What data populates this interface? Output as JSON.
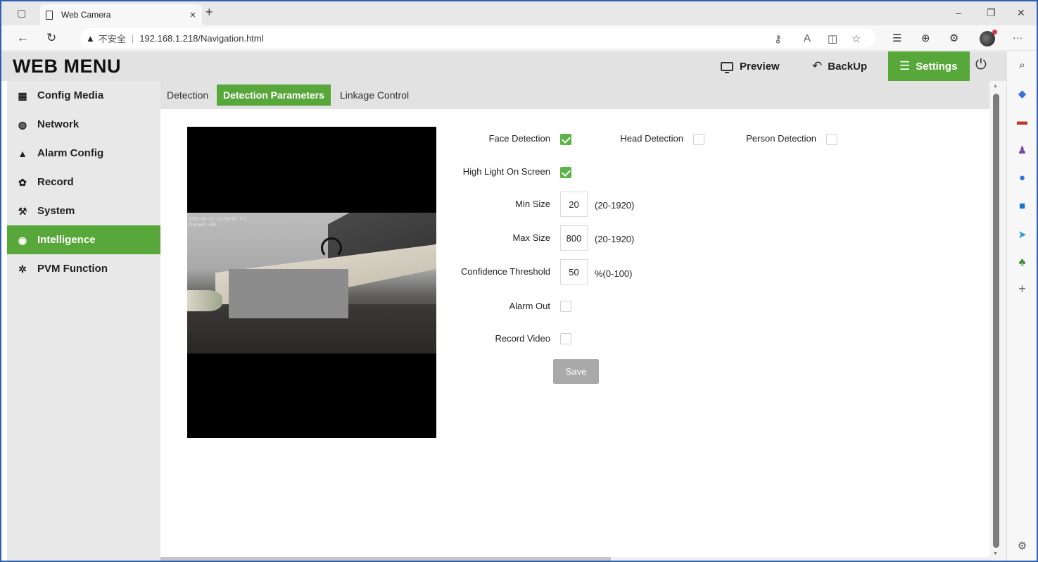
{
  "browser": {
    "tab_title": "Web Camera",
    "tab_close": "×",
    "new_tab": "+",
    "insecure_label": "不安全",
    "url": "192.168.1.218/Navigation.html",
    "window_controls": [
      "–",
      "❐",
      "✕"
    ],
    "more_menu": "···"
  },
  "header": {
    "brand": "WEB MENU",
    "preview": "Preview",
    "backup": "BackUp",
    "settings": "Settings",
    "accent_color": "#57a73a"
  },
  "sidebar": {
    "items": [
      {
        "label": "Config Media",
        "icon": "clapperboard-icon"
      },
      {
        "label": "Network",
        "icon": "globe-icon"
      },
      {
        "label": "Alarm Config",
        "icon": "alarm-icon"
      },
      {
        "label": "Record",
        "icon": "film-reel-icon"
      },
      {
        "label": "System",
        "icon": "wrench-icon"
      },
      {
        "label": "Intelligence",
        "icon": "intelligence-icon",
        "active": true
      },
      {
        "label": "PVM Function",
        "icon": "gear-icon"
      }
    ]
  },
  "subtabs": [
    {
      "label": "Detection"
    },
    {
      "label": "Detection Parameters",
      "active": true
    },
    {
      "label": "Linkage Control"
    }
  ],
  "video": {
    "osd_line1": "2025-05-21 15:59:02 Fri",
    "osd_line2": "Channel  001"
  },
  "form": {
    "face_detection": {
      "label": "Face Detection",
      "checked": true
    },
    "head_detection": {
      "label": "Head Detection",
      "checked": false
    },
    "person_detection": {
      "label": "Person Detection",
      "checked": false
    },
    "high_light": {
      "label": "High Light On Screen",
      "checked": true
    },
    "min_size": {
      "label": "Min Size",
      "value": "20",
      "range": "(20-1920)"
    },
    "max_size": {
      "label": "Max Size",
      "value": "800",
      "range": "(20-1920)"
    },
    "confidence": {
      "label": "Confidence Threshold",
      "value": "50",
      "range": "%(0-100)"
    },
    "alarm_out": {
      "label": "Alarm Out",
      "checked": false
    },
    "record_video": {
      "label": "Record Video",
      "checked": false
    },
    "save_label": "Save"
  }
}
